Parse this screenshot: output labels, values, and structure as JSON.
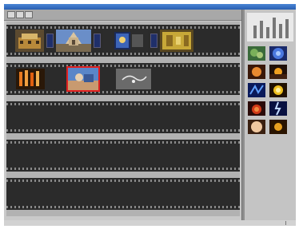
{
  "window": {
    "title": ""
  },
  "toolbar": {
    "menu_label": "",
    "buttons": [
      "timeline-button",
      "storyboard-button",
      "zoom-button"
    ]
  },
  "timeline": {
    "tracks": [
      {
        "name": "track-1",
        "clips": [
          "clip-aztec-temple",
          "clip-cathedral",
          "clip-night-window",
          "clip-gold-relief"
        ],
        "transitions": 3
      },
      {
        "name": "track-2",
        "clips": [
          "clip-orange-lights",
          "clip-blue-scene",
          "clip-sketch"
        ],
        "selected": "clip-blue-scene"
      },
      {
        "name": "track-3",
        "clips": []
      },
      {
        "name": "track-4",
        "clips": []
      },
      {
        "name": "track-5",
        "clips": []
      }
    ]
  },
  "library": {
    "thumbnails": [
      "thumb-green-leaves",
      "thumb-blue-circle",
      "thumb-orange-glow",
      "thumb-sunset",
      "thumb-neon-blue",
      "thumb-yellow-fire",
      "thumb-red-fire",
      "thumb-blue-lightning",
      "thumb-pale-fire",
      "thumb-golden-sun"
    ]
  },
  "status": {
    "text": ""
  },
  "colors": {
    "selection": "#e02020",
    "titlebar": "#2a5fb0",
    "strip": "#2b2b2b"
  }
}
